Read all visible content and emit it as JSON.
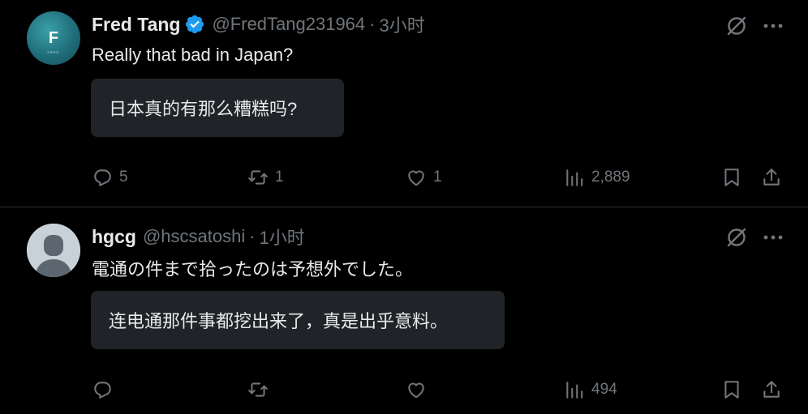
{
  "tweets": [
    {
      "avatar_letter": "F",
      "avatar_sub": "FRED",
      "name": "Fred Tang",
      "handle": "@FredTang231964",
      "separator": "·",
      "time": "3小时",
      "text": "Really that bad in Japan?",
      "translation": "日本真的有那么糟糕吗?",
      "replies": "5",
      "retweets": "1",
      "likes": "1",
      "views": "2,889"
    },
    {
      "name": "hgcg",
      "handle": "@hscsatoshi",
      "separator": "·",
      "time": "1小时",
      "text": "電通の件まで拾ったのは予想外でした。",
      "translation": "连电通那件事都挖出来了，真是出乎意料。",
      "replies": "",
      "retweets": "",
      "likes": "",
      "views": "494"
    }
  ],
  "colors": {
    "background": "#000000",
    "text": "#e7e9ea",
    "muted": "#71767b",
    "verified_badge": "#1d9bf0",
    "translation_bg": "#202327",
    "divider": "#2f3336"
  },
  "icons": [
    "verified-badge-icon",
    "grok-icon",
    "more-icon",
    "reply-icon",
    "retweet-icon",
    "like-icon",
    "views-icon",
    "bookmark-icon",
    "share-icon"
  ]
}
